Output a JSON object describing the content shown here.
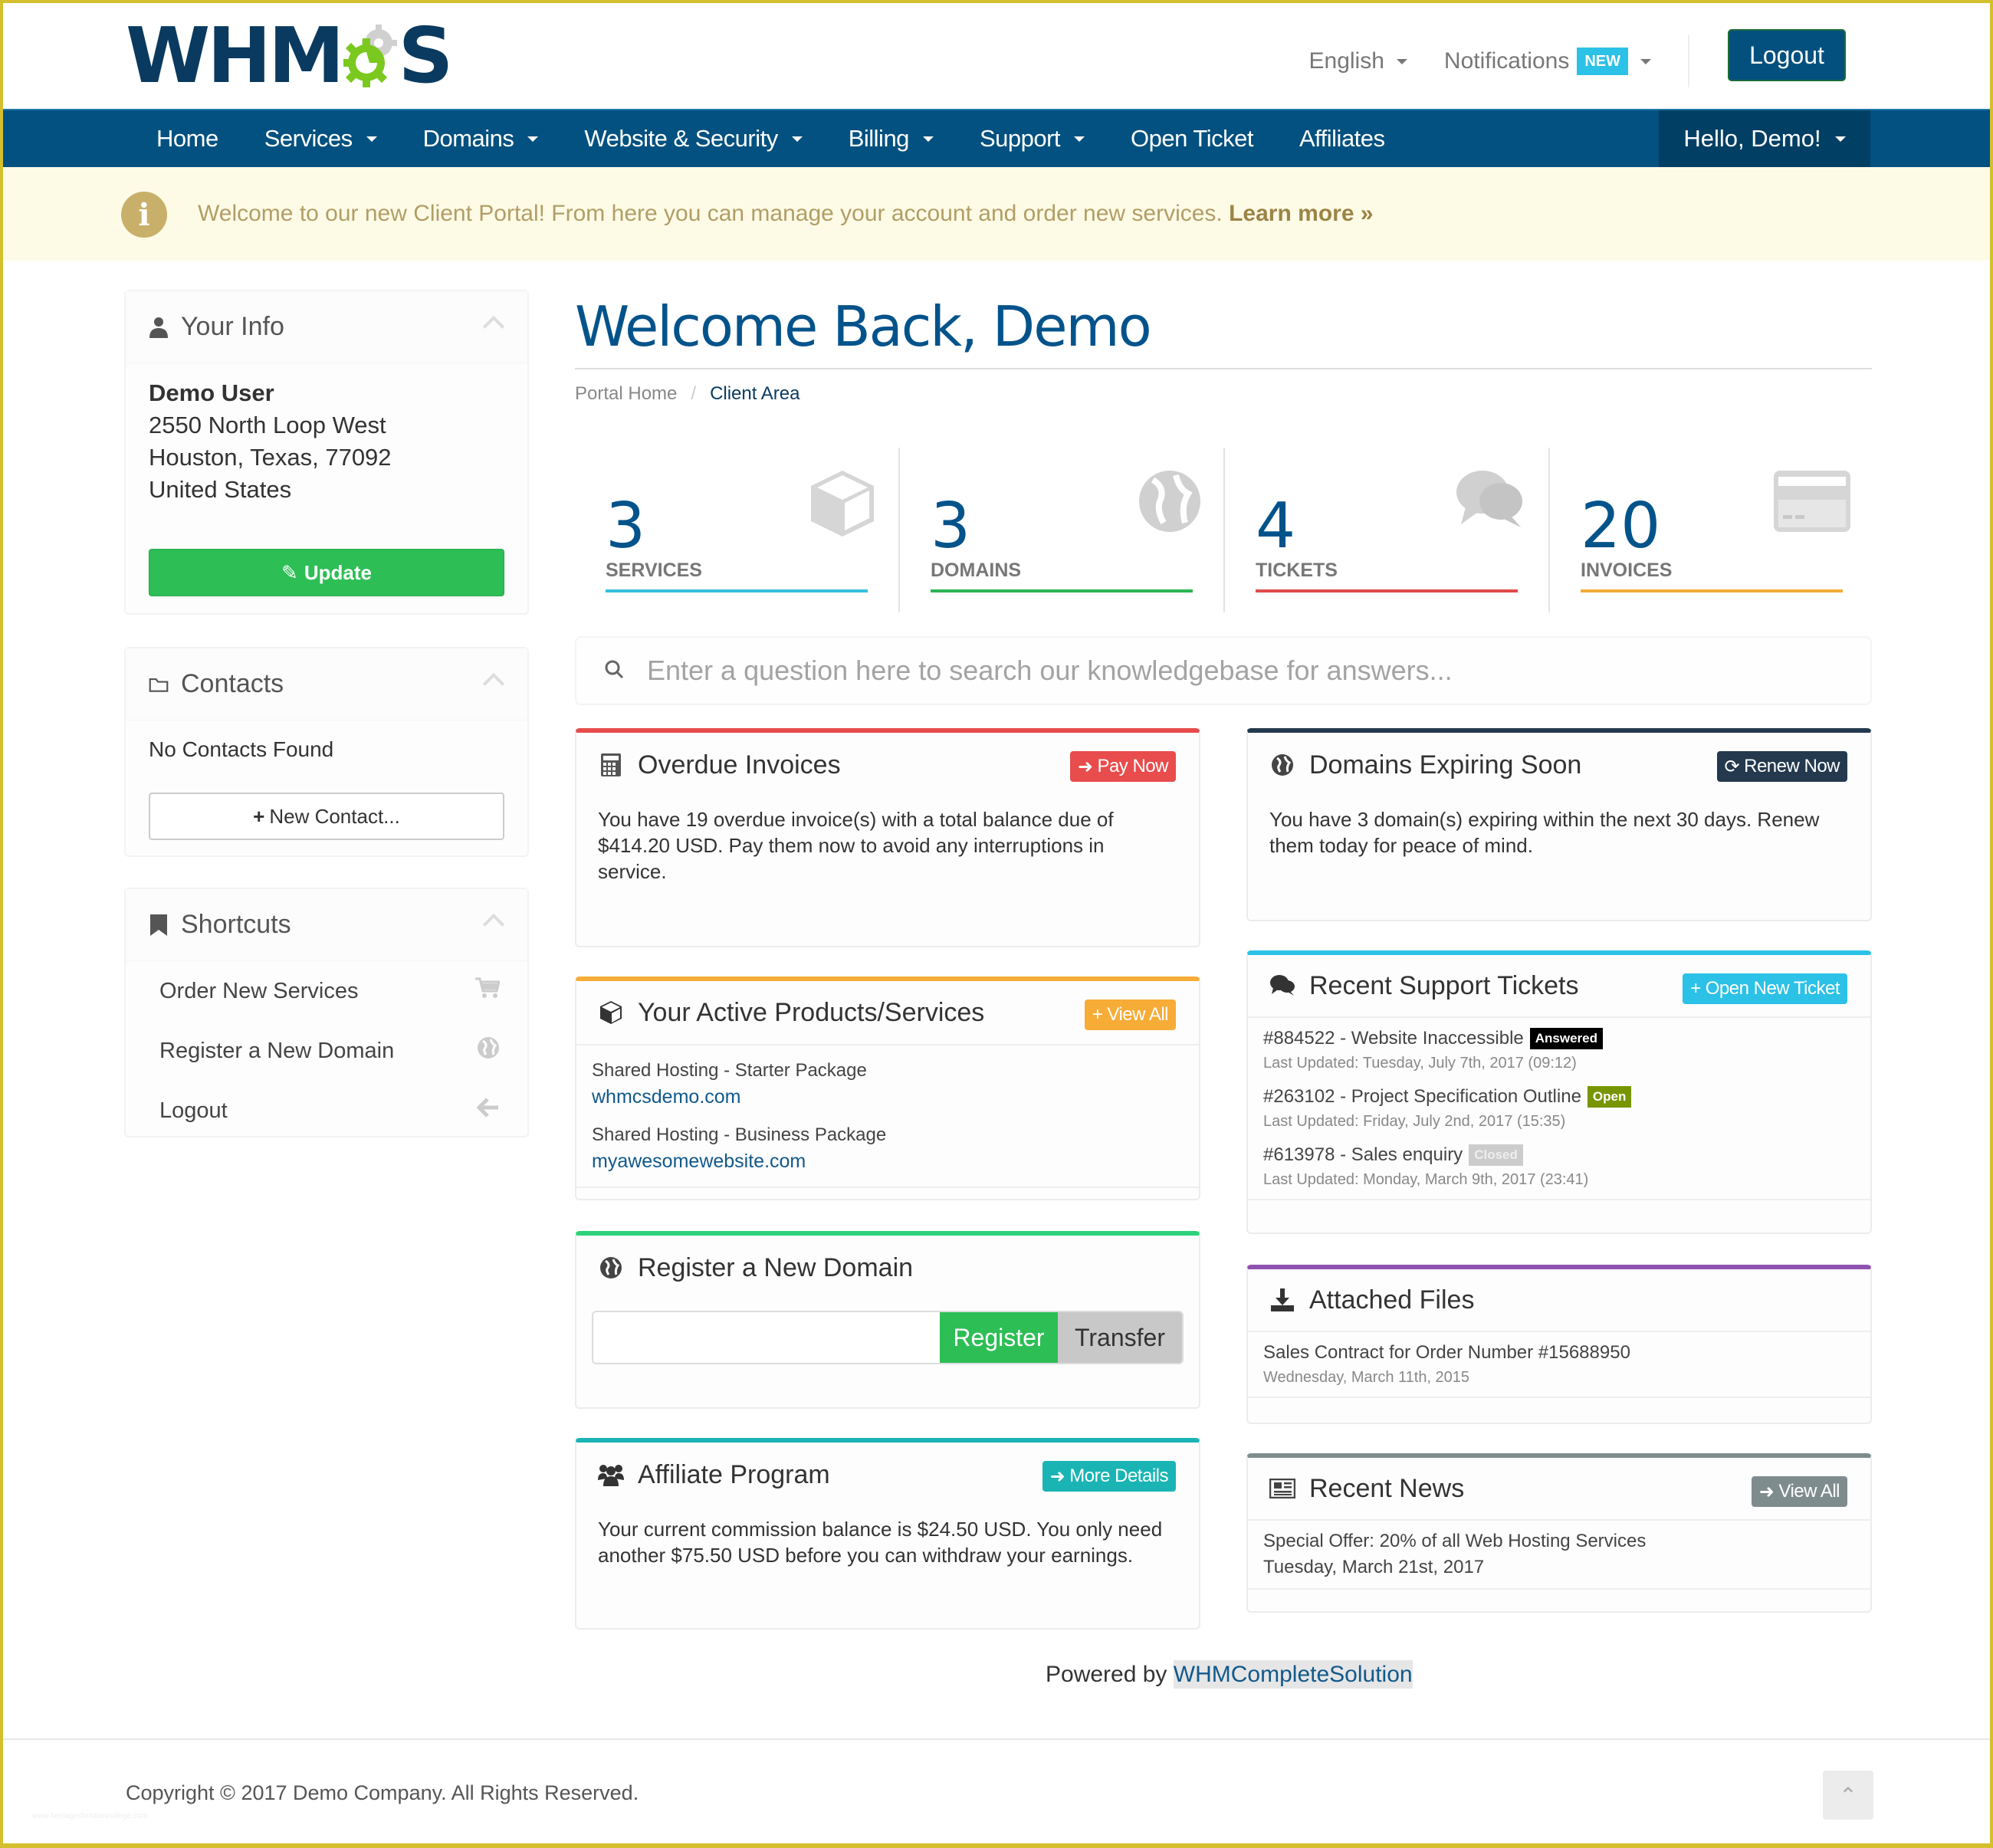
{
  "brand": {
    "logo_text_left": "WHM",
    "logo_text_right": "S",
    "colors": {
      "primary": "#025180",
      "primary_dark": "#023f64",
      "logo_green": "#7bc91f",
      "logo_gray": "#d0d0d0"
    }
  },
  "topbar": {
    "language": "English",
    "notifications": "Notifications",
    "notifications_badge": "NEW",
    "logout": "Logout"
  },
  "nav": {
    "items": [
      {
        "label": "Home",
        "dropdown": false
      },
      {
        "label": "Services",
        "dropdown": true
      },
      {
        "label": "Domains",
        "dropdown": true
      },
      {
        "label": "Website & Security",
        "dropdown": true
      },
      {
        "label": "Billing",
        "dropdown": true
      },
      {
        "label": "Support",
        "dropdown": true
      },
      {
        "label": "Open Ticket",
        "dropdown": false
      },
      {
        "label": "Affiliates",
        "dropdown": false
      }
    ],
    "user_menu": "Hello, Demo!"
  },
  "alert": {
    "text": "Welcome to our new Client Portal! From here you can manage your account and order new services.",
    "link": "Learn more »"
  },
  "sidebar": {
    "your_info": {
      "title": "Your Info",
      "name": "Demo User",
      "address1": "2550 North Loop West",
      "address2": "Houston, Texas, 77092",
      "country": "United States",
      "update_label": "Update"
    },
    "contacts": {
      "title": "Contacts",
      "empty": "No Contacts Found",
      "new_contact_label": "New Contact..."
    },
    "shortcuts": {
      "title": "Shortcuts",
      "items": [
        {
          "label": "Order New Services",
          "icon": "cart-icon"
        },
        {
          "label": "Register a New Domain",
          "icon": "globe-icon"
        },
        {
          "label": "Logout",
          "icon": "arrow-left-icon"
        }
      ]
    }
  },
  "main": {
    "title": "Welcome Back, Demo",
    "breadcrumb": [
      "Portal Home",
      "Client Area"
    ],
    "tiles": [
      {
        "value": "3",
        "label": "SERVICES",
        "color": "#36c0df",
        "icon": "cube-icon"
      },
      {
        "value": "3",
        "label": "DOMAINS",
        "color": "#2db453",
        "icon": "globe-icon"
      },
      {
        "value": "4",
        "label": "TICKETS",
        "color": "#e04a4a",
        "icon": "comments-icon"
      },
      {
        "value": "20",
        "label": "INVOICES",
        "color": "#f0ad36",
        "icon": "credit-card-icon"
      }
    ],
    "kb_search_placeholder": "Enter a question here to search our knowledgebase for answers...",
    "overdue": {
      "title": "Overdue Invoices",
      "button": "Pay Now",
      "text": "You have 19 overdue invoice(s) with a total balance due of $414.20 USD. Pay them now to avoid any interruptions in service.",
      "color": "#e74c4c"
    },
    "domains_expiring": {
      "title": "Domains Expiring Soon",
      "button": "Renew Now",
      "text": "You have 3 domain(s) expiring within the next 30 days. Renew them today for peace of mind.",
      "color": "#24394e"
    },
    "products": {
      "title": "Your Active Products/Services",
      "button": "View All",
      "color": "#f6ac36",
      "items": [
        {
          "name": "Shared Hosting - Starter Package",
          "domain": "whmcsdemo.com"
        },
        {
          "name": "Shared Hosting - Business Package",
          "domain": "myawesomewebsite.com"
        }
      ]
    },
    "tickets": {
      "title": "Recent Support Tickets",
      "button": "Open New Ticket",
      "color": "#2cc1e6",
      "items": [
        {
          "title": "#884522 - Website Inaccessible",
          "status": "Answered",
          "status_color": "#000000",
          "updated": "Last Updated: Tuesday, July 7th, 2017 (09:12)"
        },
        {
          "title": "#263102 - Project Specification Outline",
          "status": "Open",
          "status_color": "#779500",
          "updated": "Last Updated: Friday, July 2nd, 2017 (15:35)"
        },
        {
          "title": "#613978 - Sales enquiry",
          "status": "Closed",
          "status_color": "#cccccc",
          "updated": "Last Updated: Monday, March 9th, 2017 (23:41)"
        }
      ]
    },
    "register_domain": {
      "title": "Register a New Domain",
      "input_value": "",
      "register": "Register",
      "transfer": "Transfer",
      "color": "#2ed27a"
    },
    "attached_files": {
      "title": "Attached Files",
      "color": "#8e52b0",
      "items": [
        {
          "name": "Sales Contract for Order Number #15688950",
          "date": "Wednesday, March 11th, 2015"
        }
      ]
    },
    "affiliate": {
      "title": "Affiliate Program",
      "button": "More Details",
      "text": "Your current commission balance is $24.50 USD. You only need another $75.50 USD before you can withdraw your earnings.",
      "color": "#1ab4b4"
    },
    "news": {
      "title": "Recent News",
      "button": "View All",
      "color": "#7f8c8d",
      "items": [
        {
          "title": "Special Offer: 20% of all Web Hosting Services",
          "date": "Tuesday, March 21st, 2017"
        }
      ]
    }
  },
  "footer": {
    "powered_prefix": "Powered by",
    "powered_link": "WHMCompleteSolution",
    "copyright": "Copyright © 2017 Demo Company. All Rights Reserved.",
    "watermark": "www.heritagechristiancollege.com"
  }
}
